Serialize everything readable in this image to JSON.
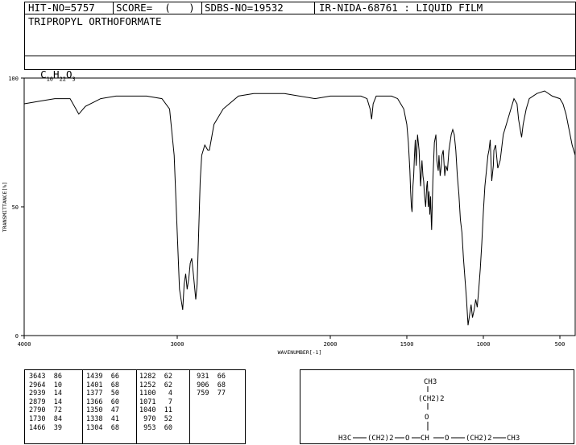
{
  "header": {
    "hit_no": "HIT-NO=5757",
    "score": "SCORE=  (   )",
    "sdbs_no": "SDBS-NO=19532",
    "ir_nida": "IR-NIDA-68761 : LIQUID FILM",
    "compound_name": "TRIPROPYL ORTHOFORMATE",
    "formula": {
      "c": "C",
      "c_n": "10",
      "h": "H",
      "h_n": "22",
      "o": "O",
      "o_n": "3"
    }
  },
  "chart_data": {
    "type": "line",
    "title": "",
    "xlabel": "WAVENUMBER[-1]",
    "ylabel": "TRANSMITTANCE[%]",
    "xlim": [
      4000,
      400
    ],
    "ylim": [
      0,
      100
    ],
    "x_ticks": [
      "4000",
      "3000",
      "2000",
      "1500",
      "1000",
      "500"
    ],
    "y_ticks": [
      "100",
      "50",
      "0"
    ],
    "grid": false,
    "series": [
      {
        "name": "",
        "color": "#000000",
        "x": [
          4000,
          3900,
          3800,
          3700,
          3643,
          3600,
          3500,
          3400,
          3300,
          3200,
          3100,
          3050,
          3020,
          3000,
          2985,
          2975,
          2964,
          2955,
          2945,
          2935,
          2925,
          2915,
          2905,
          2895,
          2885,
          2879,
          2870,
          2860,
          2850,
          2840,
          2830,
          2820,
          2800,
          2790,
          2760,
          2700,
          2600,
          2500,
          2300,
          2100,
          2000,
          1900,
          1800,
          1760,
          1740,
          1730,
          1720,
          1700,
          1650,
          1600,
          1560,
          1520,
          1500,
          1490,
          1480,
          1475,
          1470,
          1466,
          1460,
          1455,
          1450,
          1445,
          1439,
          1430,
          1420,
          1410,
          1401,
          1395,
          1390,
          1385,
          1377,
          1370,
          1366,
          1360,
          1355,
          1350,
          1345,
          1340,
          1338,
          1330,
          1320,
          1310,
          1304,
          1295,
          1290,
          1282,
          1275,
          1270,
          1262,
          1252,
          1245,
          1235,
          1225,
          1210,
          1200,
          1190,
          1180,
          1170,
          1160,
          1150,
          1140,
          1130,
          1120,
          1110,
          1100,
          1090,
          1080,
          1071,
          1060,
          1050,
          1040,
          1030,
          1020,
          1010,
          1000,
          990,
          980,
          970,
          963,
          955,
          945,
          935,
          931,
          920,
          906,
          890,
          870,
          850,
          820,
          800,
          780,
          770,
          759,
          750,
          740,
          720,
          700,
          650,
          600,
          550,
          500,
          480,
          460,
          440,
          420,
          400
        ],
        "y": [
          90,
          91,
          92,
          92,
          86,
          89,
          92,
          93,
          93,
          93,
          92,
          88,
          70,
          40,
          18,
          14,
          10,
          20,
          24,
          18,
          22,
          28,
          30,
          24,
          18,
          14,
          20,
          40,
          60,
          70,
          72,
          74,
          72,
          72,
          82,
          88,
          93,
          94,
          94,
          92,
          93,
          93,
          93,
          92,
          88,
          84,
          90,
          93,
          93,
          93,
          92,
          88,
          82,
          75,
          64,
          56,
          50,
          48,
          58,
          62,
          70,
          76,
          66,
          78,
          72,
          58,
          68,
          62,
          60,
          55,
          50,
          58,
          60,
          50,
          56,
          47,
          54,
          44,
          41,
          60,
          75,
          78,
          68,
          64,
          70,
          62,
          66,
          70,
          72,
          62,
          66,
          64,
          72,
          78,
          80,
          78,
          72,
          62,
          55,
          45,
          40,
          30,
          22,
          14,
          4,
          8,
          12,
          7,
          10,
          14,
          11,
          18,
          26,
          36,
          48,
          58,
          64,
          70,
          72,
          76,
          60,
          66,
          72,
          74,
          65,
          68,
          78,
          82,
          88,
          92,
          90,
          84,
          80,
          77,
          82,
          88,
          92,
          94,
          95,
          93,
          92,
          90,
          86,
          80,
          74,
          70
        ]
      }
    ],
    "annotations": []
  },
  "peak_table": {
    "columns": [
      [
        [
          "3643",
          "86"
        ],
        [
          "2964",
          "10"
        ],
        [
          "2939",
          "14"
        ],
        [
          "2879",
          "14"
        ],
        [
          "2790",
          "72"
        ],
        [
          "1730",
          "84"
        ],
        [
          "1466",
          "39"
        ]
      ],
      [
        [
          "1439",
          "66"
        ],
        [
          "1401",
          "68"
        ],
        [
          "1377",
          "50"
        ],
        [
          "1366",
          "60"
        ],
        [
          "1350",
          "47"
        ],
        [
          "1338",
          "41"
        ],
        [
          "1304",
          "68"
        ]
      ],
      [
        [
          "1282",
          "62"
        ],
        [
          "1252",
          "62"
        ],
        [
          "1100",
          " 4"
        ],
        [
          "1071",
          " 7"
        ],
        [
          "1040",
          "11"
        ],
        [
          " 970",
          "52"
        ],
        [
          " 953",
          "60"
        ]
      ],
      [
        [
          " 931",
          "66"
        ],
        [
          " 906",
          "68"
        ],
        [
          " 759",
          "77"
        ]
      ]
    ]
  },
  "structure": {
    "ch3_top": "CH3",
    "ch2_top": "(CH2)2",
    "o_top": "O",
    "left_h3c": "H3C",
    "left_ch2": "(CH2)2",
    "o_left": "O",
    "ch": "CH",
    "o_right": "O",
    "right_ch2": "(CH2)2",
    "right_ch3": "CH3"
  }
}
